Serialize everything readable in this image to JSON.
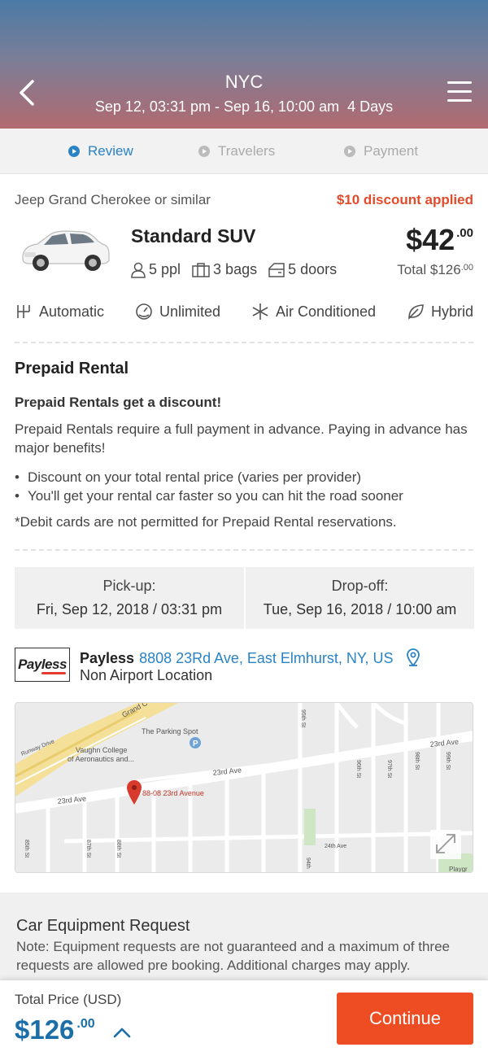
{
  "header": {
    "city": "NYC",
    "dates": "Sep 12, 03:31 pm - Sep 16, 10:00 am",
    "duration": "4 Days"
  },
  "steps": [
    {
      "label": "Review",
      "active": true
    },
    {
      "label": "Travelers",
      "active": false
    },
    {
      "label": "Payment",
      "active": false
    }
  ],
  "car": {
    "model": "Jeep Grand Cherokee or similar",
    "discount": "$10 discount applied",
    "class": "Standard SUV",
    "price_whole": "$42",
    "price_cents": ".00",
    "people": "5 ppl",
    "bags": "3 bags",
    "doors": "5 doors",
    "total_label": "Total $126",
    "total_cents": ".00",
    "features": [
      "Automatic",
      "Unlimited",
      "Air Conditioned",
      "Hybrid"
    ]
  },
  "prepaid": {
    "title": "Prepaid Rental",
    "subtitle": "Prepaid Rentals get a discount!",
    "description": "Prepaid Rentals require a full payment in advance. Paying in advance has major benefits!",
    "bullets": [
      "Discount on your total rental price (varies per provider)",
      "You'll get your rental car faster so you can hit the road sooner"
    ],
    "debit_note": "*Debit cards are not permitted for Prepaid Rental reservations."
  },
  "pickup": {
    "label": "Pick-up:",
    "value": "Fri, Sep 12, 2018 / 03:31 pm"
  },
  "dropoff": {
    "label": "Drop-off:",
    "value": "Tue, Sep 16, 2018 / 10:00 am"
  },
  "vendor": {
    "logo_text": "Payless",
    "name": "Payless",
    "address": "8808 23Rd Ave, East Elmhurst, NY, US",
    "location_type": "Non Airport Location"
  },
  "map": {
    "labels": {
      "grand": "Grand C",
      "runway": "Runway Drive",
      "parking": "The Parking Spot",
      "college1": "Vaughn College",
      "college2": "of Aeronautics and...",
      "ave1": "23rd Ave",
      "ave2": "23rd Ave",
      "ave3": "23rd Ave",
      "ave24": "24th Ave",
      "marker": "88-08 23rd Avenue",
      "playground": "Playgr",
      "st95": "95th St",
      "st96": "96th St",
      "st97": "97th St",
      "st98": "98th St",
      "st99": "99th St",
      "st85": "85th St",
      "st87": "87th St",
      "st88": "88th St",
      "st94": "94th"
    }
  },
  "equipment": {
    "title": "Car Equipment Request",
    "note": "Note: Equipment requests are not guaranteed and a maximum of three requests are allowed pre booking. Additional charges may apply."
  },
  "footer": {
    "total_label": "Total Price (USD)",
    "total_whole": "$126",
    "total_cents": ".00",
    "continue_label": "Continue"
  },
  "colors": {
    "accent_blue": "#2a83c6",
    "discount_red": "#e24b2a",
    "continue_orange": "#ee4c23",
    "price_blue": "#1b6ea8"
  }
}
